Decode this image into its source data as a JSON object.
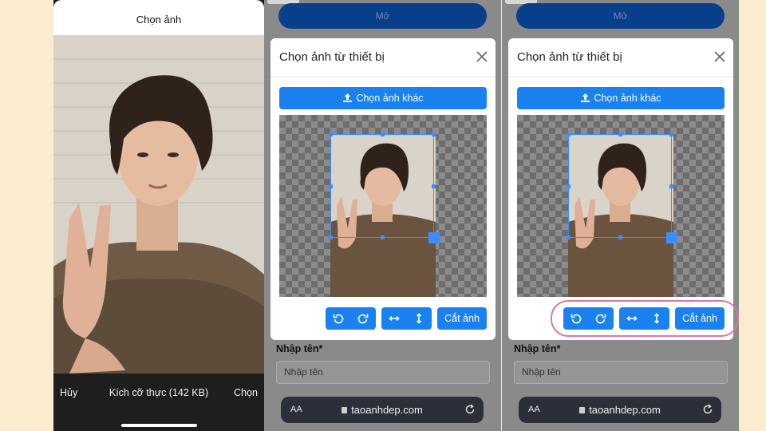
{
  "picker": {
    "title": "Chọn ảnh",
    "cancel_label": "Hủy",
    "size_label": "Kích cỡ thực (142 KB)",
    "choose_label": "Chọn"
  },
  "screens": [
    {
      "open_button": "Mở",
      "modal": {
        "title": "Chọn ảnh từ thiết bị",
        "upload_label": "Chọn ảnh khác",
        "crop_label": "Cắt ảnh"
      },
      "name_label": "Nhập tên*",
      "name_placeholder": "Nhập tên",
      "browser": {
        "aa": "AA",
        "url": "taoanhdep.com"
      }
    },
    {
      "open_button": "Mở",
      "modal": {
        "title": "Chọn ảnh từ thiết bị",
        "upload_label": "Chọn ảnh khác",
        "crop_label": "Cắt ảnh"
      },
      "name_label": "Nhập tên*",
      "name_placeholder": "Nhập tên",
      "browser": {
        "aa": "AA",
        "url": "taoanhdep.com"
      }
    }
  ],
  "colors": {
    "background": "#fbecd0",
    "primary_button": "#1a82f0",
    "crop_outline": "#3a8eff",
    "highlight_ring": "#d978a6"
  }
}
